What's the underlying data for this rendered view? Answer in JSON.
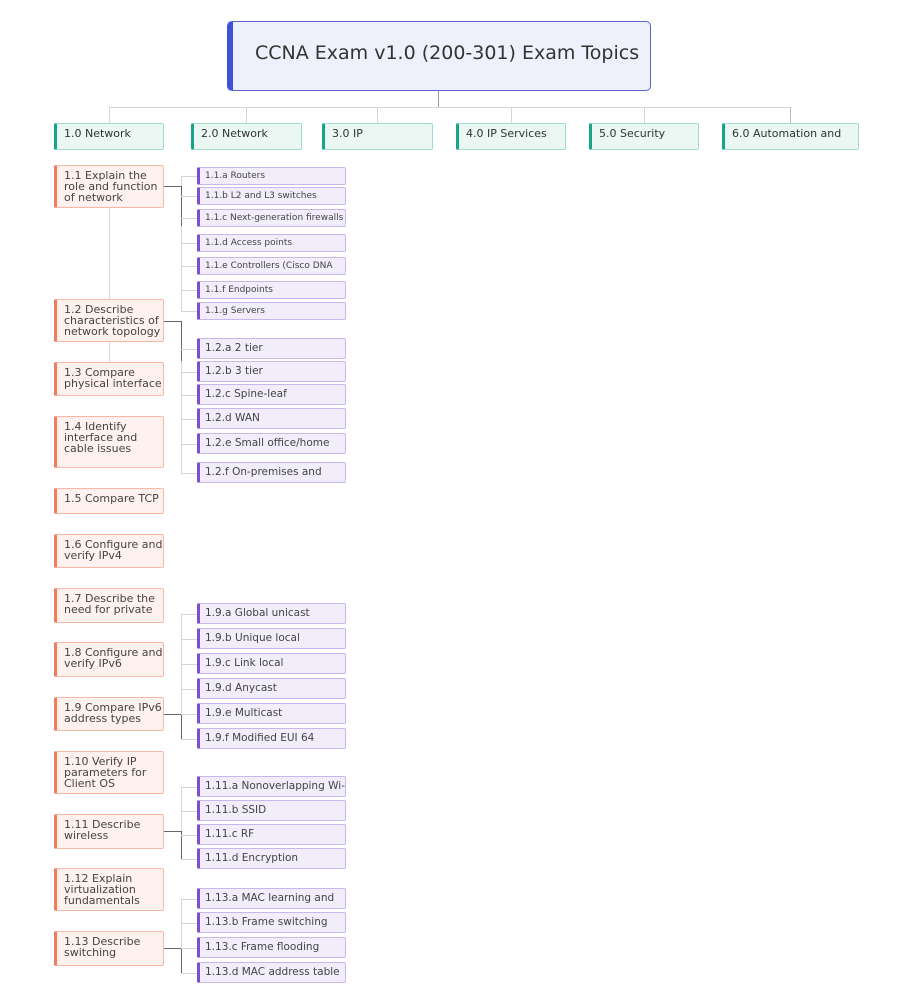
{
  "root": {
    "title": "CCNA Exam v1.0 (200-301) Exam Topics"
  },
  "categories": [
    {
      "label": "1.0 Network"
    },
    {
      "label": "2.0 Network"
    },
    {
      "label": "3.0 IP"
    },
    {
      "label": "4.0 IP Services"
    },
    {
      "label": "5.0 Security"
    },
    {
      "label": "6.0 Automation and"
    }
  ],
  "topics": [
    {
      "label": "1.1 Explain the role and function of network",
      "subitems": [
        "1.1.a Routers",
        "1.1.b L2 and L3 switches",
        "1.1.c Next-generation firewalls",
        "1.1.d Access points",
        "1.1.e Controllers (Cisco DNA",
        "1.1.f Endpoints",
        "1.1.g Servers"
      ]
    },
    {
      "label": "1.2 Describe characteristics of network topology",
      "subitems": [
        "1.2.a 2 tier",
        "1.2.b 3 tier",
        "1.2.c Spine-leaf",
        "1.2.d WAN",
        "1.2.e Small office/home",
        "1.2.f On-premises and"
      ]
    },
    {
      "label": "1.3 Compare physical interface",
      "subitems": []
    },
    {
      "label": "1.4 Identify interface and cable issues",
      "subitems": []
    },
    {
      "label": "1.5 Compare TCP",
      "subitems": []
    },
    {
      "label": "1.6 Configure and verify IPv4",
      "subitems": []
    },
    {
      "label": "1.7 Describe the need for private",
      "subitems": []
    },
    {
      "label": "1.8 Configure and verify IPv6",
      "subitems": []
    },
    {
      "label": "1.9 Compare IPv6 address types",
      "subitems": [
        "1.9.a Global unicast",
        "1.9.b Unique local",
        "1.9.c Link local",
        "1.9.d Anycast",
        "1.9.e Multicast",
        "1.9.f Modified EUI 64"
      ]
    },
    {
      "label": "1.10 Verify IP parameters for Client OS",
      "subitems": []
    },
    {
      "label": "1.11 Describe wireless",
      "subitems": [
        "1.11.a Nonoverlapping Wi-",
        "1.11.b SSID",
        "1.11.c RF",
        "1.11.d Encryption"
      ]
    },
    {
      "label": "1.12 Explain virtualization fundamentals",
      "subitems": []
    },
    {
      "label": "1.13 Describe switching",
      "subitems": [
        "1.13.a MAC learning and",
        "1.13.b Frame switching",
        "1.13.c Frame flooding",
        "1.13.d MAC address table"
      ]
    }
  ],
  "colors": {
    "root_accent": "#4150d8",
    "category_accent": "#17a589",
    "topic_accent": "#f27a5b",
    "subitem_accent": "#7b4fd0"
  }
}
